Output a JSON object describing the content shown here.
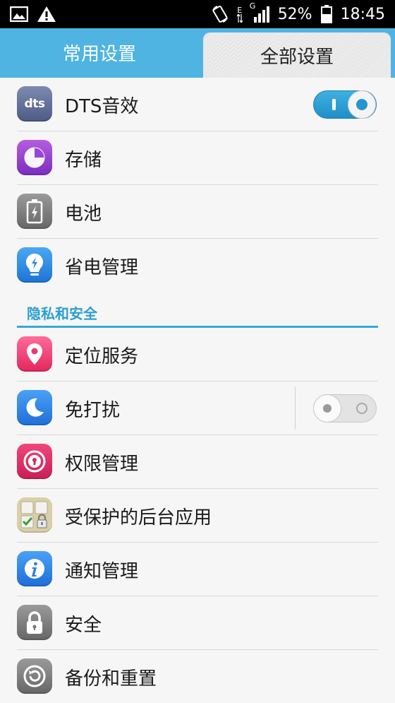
{
  "status_bar": {
    "battery_percent": "52%",
    "time": "18:45",
    "network_label_1": "E",
    "network_label_2": "G",
    "icons": [
      "image-icon",
      "warning-icon",
      "rotate-lock-icon",
      "data-arrows-icon",
      "signal-icon",
      "battery-icon"
    ]
  },
  "tabs": [
    {
      "label": "常用设置",
      "selected": false
    },
    {
      "label": "全部设置",
      "selected": true
    }
  ],
  "rows_top": [
    {
      "label": "DTS音效",
      "icon": "dts-icon",
      "toggle": "on"
    },
    {
      "label": "存储",
      "icon": "storage-icon"
    },
    {
      "label": "电池",
      "icon": "battery-icon"
    },
    {
      "label": "省电管理",
      "icon": "power-saving-icon"
    }
  ],
  "section": {
    "label": "隐私和安全"
  },
  "rows_privacy": [
    {
      "label": "定位服务",
      "icon": "location-icon"
    },
    {
      "label": "免打扰",
      "icon": "moon-icon",
      "toggle": "off"
    },
    {
      "label": "权限管理",
      "icon": "keyhole-icon"
    },
    {
      "label": "受保护的后台应用",
      "icon": "protected-apps-icon"
    },
    {
      "label": "通知管理",
      "icon": "info-icon"
    },
    {
      "label": "安全",
      "icon": "lock-icon"
    },
    {
      "label": "备份和重置",
      "icon": "backup-icon"
    }
  ],
  "icons": {
    "dts_text": "dts"
  },
  "colors": {
    "accent": "#33aadc",
    "tab_bar": "#4fb4e2",
    "section_text": "#2a9fd0"
  }
}
